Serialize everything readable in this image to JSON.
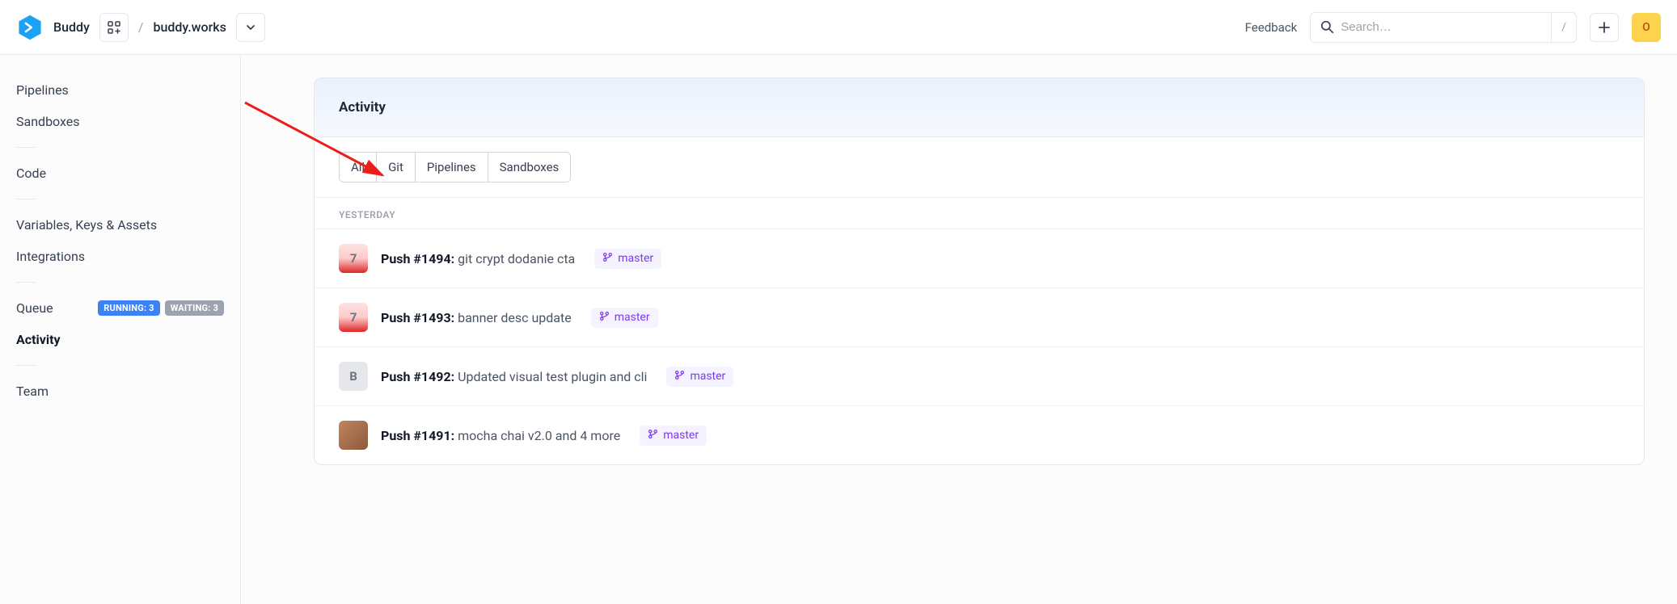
{
  "header": {
    "brand": "Buddy",
    "breadcrumb": "buddy.works",
    "feedback": "Feedback",
    "search_placeholder": "Search…",
    "search_shortcut": "/",
    "avatar_initial": "O"
  },
  "sidebar": {
    "pipelines": "Pipelines",
    "sandboxes": "Sandboxes",
    "code": "Code",
    "variables": "Variables, Keys & Assets",
    "integrations": "Integrations",
    "queue": "Queue",
    "activity": "Activity",
    "team": "Team",
    "badge_running": "RUNNING: 3",
    "badge_waiting": "WAITING: 3"
  },
  "panel": {
    "title": "Activity",
    "tabs": {
      "all": "All",
      "git": "Git",
      "pipelines": "Pipelines",
      "sandboxes": "Sandboxes"
    },
    "section_yesterday": "YESTERDAY",
    "items": [
      {
        "avatar_class": "av-red",
        "avatar_text": "7",
        "title": "Push #1494:",
        "desc": "git crypt dodanie cta",
        "branch": "master"
      },
      {
        "avatar_class": "av-red",
        "avatar_text": "7",
        "title": "Push #1493:",
        "desc": "banner desc update",
        "branch": "master"
      },
      {
        "avatar_class": "av-grey",
        "avatar_text": "B",
        "title": "Push #1492:",
        "desc": "Updated visual test plugin and cli",
        "branch": "master"
      },
      {
        "avatar_class": "av-photo",
        "avatar_text": "",
        "title": "Push #1491:",
        "desc": "mocha chai v2.0 and 4 more",
        "branch": "master"
      }
    ]
  }
}
